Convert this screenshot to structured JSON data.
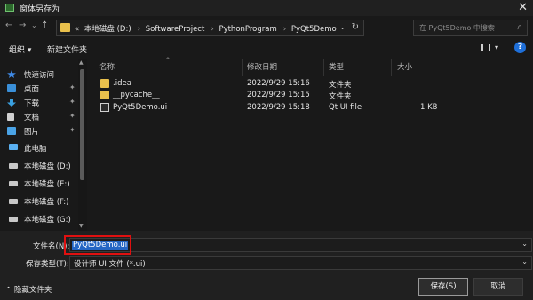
{
  "window": {
    "title": "窗体另存为",
    "close": "✕"
  },
  "nav": {
    "back": "←",
    "forward": "→",
    "dropdown": "⌄",
    "up": "↑"
  },
  "address": {
    "prefix": "«",
    "crumbs": [
      "本地磁盘 (D:)",
      "SoftwareProject",
      "PythonProgram",
      "PyQt5Demo"
    ],
    "separator": "›",
    "refresh": "↻"
  },
  "search": {
    "placeholder": "在 PyQt5Demo 中搜索"
  },
  "toolbar": {
    "organize": "组织 ▾",
    "new_folder": "新建文件夹",
    "help": "?"
  },
  "sidebar": {
    "items": [
      {
        "label": "快速访问",
        "icon": "star-icon",
        "color": "#3f8ae6",
        "pinned": false
      },
      {
        "label": "桌面",
        "icon": "desktop-icon",
        "color": "#3a8fd8",
        "pinned": true
      },
      {
        "label": "下载",
        "icon": "download-icon",
        "color": "#3aa0e0",
        "pinned": true
      },
      {
        "label": "文档",
        "icon": "document-icon",
        "color": "#d0d0d0",
        "pinned": true
      },
      {
        "label": "图片",
        "icon": "picture-icon",
        "color": "#4aa3e6",
        "pinned": true
      },
      {
        "label": "此电脑",
        "icon": "computer-icon",
        "color": "#5ab0f0",
        "pinned": false
      },
      {
        "label": "本地磁盘 (D:)",
        "icon": "drive-icon",
        "color": "#c8c8c8",
        "pinned": false
      },
      {
        "label": "本地磁盘 (E:)",
        "icon": "drive-icon",
        "color": "#c8c8c8",
        "pinned": false
      },
      {
        "label": "本地磁盘 (F:)",
        "icon": "drive-icon",
        "color": "#c8c8c8",
        "pinned": false
      },
      {
        "label": "本地磁盘 (G:)",
        "icon": "drive-icon",
        "color": "#c8c8c8",
        "pinned": false
      }
    ],
    "pin_glyph": "📌"
  },
  "columns": {
    "name": "名称",
    "date": "修改日期",
    "type": "类型",
    "size": "大小"
  },
  "files": [
    {
      "name": ".idea",
      "date": "2022/9/29 15:16",
      "type": "文件夹",
      "size": "",
      "kind": "folder"
    },
    {
      "name": "__pycache__",
      "date": "2022/9/29 15:15",
      "type": "文件夹",
      "size": "",
      "kind": "folder"
    },
    {
      "name": "PyQt5Demo.ui",
      "date": "2022/9/29 15:18",
      "type": "Qt UI file",
      "size": "1 KB",
      "kind": "file"
    }
  ],
  "form": {
    "filename_label": "文件名(N):",
    "filename_value": "PyQt5Demo.ui",
    "filetype_label": "保存类型(T):",
    "filetype_value": "设计师 UI 文件 (*.ui)",
    "hide_folders": "⌃ 隐藏文件夹",
    "save": "保存(S)",
    "cancel": "取消"
  },
  "colors": {
    "accent": "#2466c4",
    "highlight_box": "#e01010",
    "folder": "#e9c04c"
  }
}
